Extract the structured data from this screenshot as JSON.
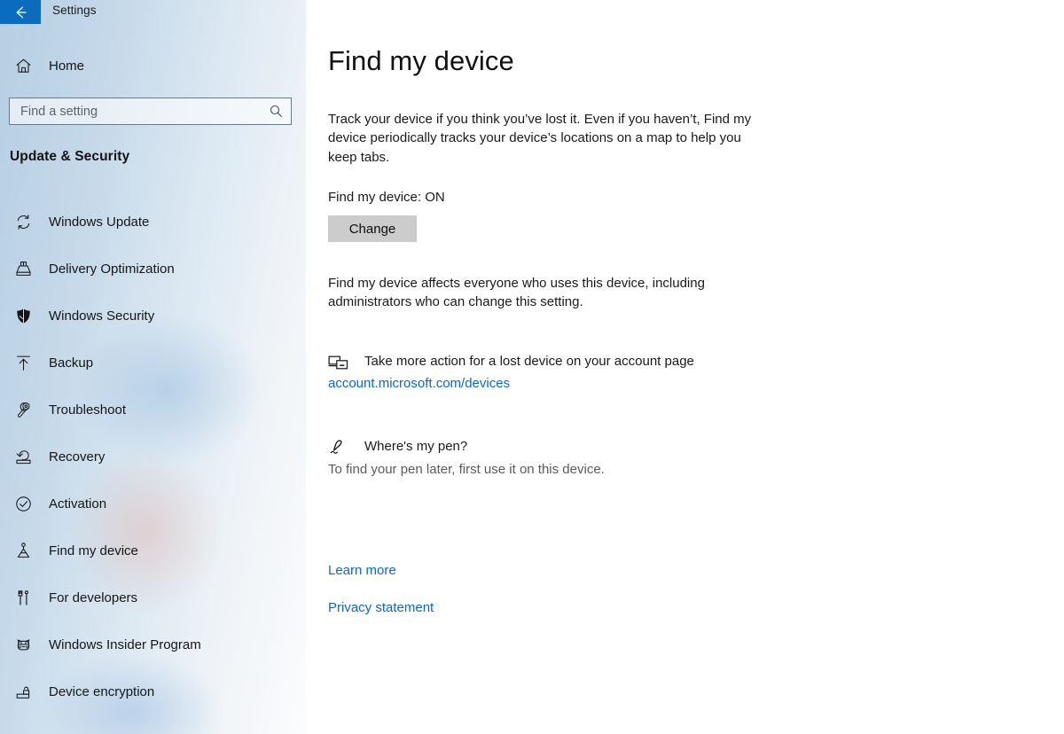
{
  "window": {
    "title": "Settings",
    "back_icon": "back-arrow-icon",
    "accent_color": "#0b6cbd"
  },
  "sidebar": {
    "home": {
      "label": "Home",
      "icon": "home-icon"
    },
    "search": {
      "placeholder": "Find a setting",
      "value": "",
      "icon": "search-icon"
    },
    "section_title": "Update & Security",
    "items": [
      {
        "label": "Windows Update",
        "icon": "sync-refresh-icon"
      },
      {
        "label": "Delivery Optimization",
        "icon": "delivery-box-icon"
      },
      {
        "label": "Windows Security",
        "icon": "shield-icon"
      },
      {
        "label": "Backup",
        "icon": "upload-arrow-icon"
      },
      {
        "label": "Troubleshoot",
        "icon": "wrench-icon"
      },
      {
        "label": "Recovery",
        "icon": "recovery-arrow-icon"
      },
      {
        "label": "Activation",
        "icon": "check-circle-icon"
      },
      {
        "label": "Find my device",
        "icon": "location-beacon-icon"
      },
      {
        "label": "For developers",
        "icon": "tools-icon"
      },
      {
        "label": "Windows Insider Program",
        "icon": "ninja-cat-icon"
      },
      {
        "label": "Device encryption",
        "icon": "drive-lock-icon"
      }
    ]
  },
  "main": {
    "page_title": "Find my device",
    "intro": "Track your device if you think you’ve lost it. Even if you haven’t, Find my device periodically tracks your device’s locations on a map to help you keep tabs.",
    "status_line": "Find my device: ON",
    "change_button": "Change",
    "admin_note": "Find my device affects everyone who uses this device, including administrators who can change this setting.",
    "account_section": {
      "icon": "devices-icon",
      "text": "Take more action for a lost device on your account page",
      "link": "account.microsoft.com/devices",
      "link_color": "#0a69c8"
    },
    "pen_section": {
      "icon": "pen-icon",
      "title": "Where's my pen?",
      "subtitle": "To find your pen later, first use it on this device."
    },
    "links": {
      "learn_more": "Learn more",
      "privacy_statement": "Privacy statement"
    }
  }
}
